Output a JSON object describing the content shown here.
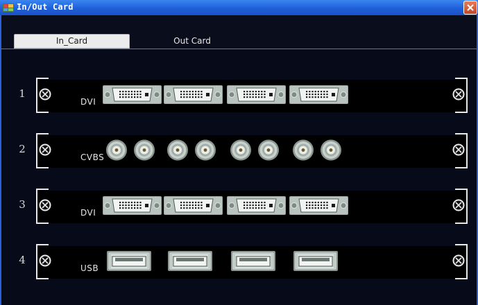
{
  "window": {
    "title": "In/Out Card",
    "app_icon": "app-icon",
    "close_icon": "close-icon"
  },
  "tabs": [
    {
      "label": "In_Card",
      "selected": true
    },
    {
      "label": "Out Card",
      "selected": false
    }
  ],
  "slots": [
    {
      "number": "1",
      "label": "DVI",
      "port_type": "dvi",
      "port_count": 4
    },
    {
      "number": "2",
      "label": "CVBS",
      "port_type": "bnc-pair",
      "port_count": 4
    },
    {
      "number": "3",
      "label": "DVI",
      "port_type": "dvi",
      "port_count": 4
    },
    {
      "number": "4",
      "label": "USB",
      "port_type": "usb",
      "port_count": 4
    }
  ],
  "colors": {
    "titlebar": "#1f5fd9",
    "panel_background": "#070a18",
    "card_background": "#000000"
  }
}
